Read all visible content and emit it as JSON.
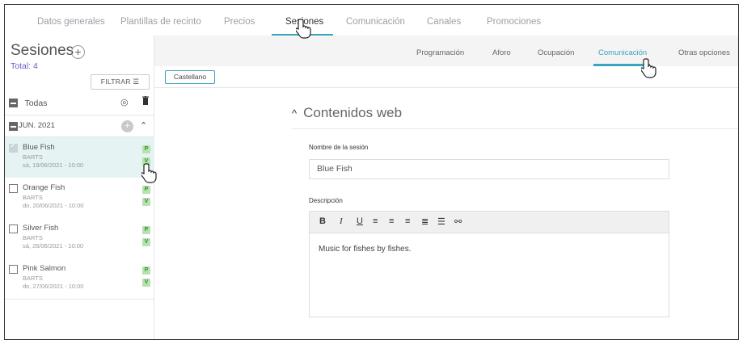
{
  "top_tabs": [
    "Datos generales",
    "Plantillas de recinto",
    "Precios",
    "Sesiones",
    "Comunicación",
    "Canales",
    "Promociones"
  ],
  "active_top_tab": "Sesiones",
  "sidebar": {
    "title": "Sesiones",
    "add_icon": "plus-icon",
    "total": "Total: 4",
    "filter_label": "FILTRAR",
    "select_all_label": "Todas",
    "group_label": "JUN. 2021",
    "items": [
      {
        "name": "Blue Fish",
        "venue": "BARTS",
        "date": "sá, 19/06/2021 - 10:00",
        "selected": true
      },
      {
        "name": "Orange Fish",
        "venue": "BARTS",
        "date": "do, 20/06/2021 - 10:00",
        "selected": false
      },
      {
        "name": "Silver Fish",
        "venue": "BARTS",
        "date": "sá, 26/06/2021 - 10:00",
        "selected": false
      },
      {
        "name": "Pink Salmon",
        "venue": "BARTS",
        "date": "do, 27/06/2021 - 10:00",
        "selected": false
      }
    ],
    "badge_p": "P",
    "badge_v": "V"
  },
  "sub_tabs": [
    "Programación",
    "Aforo",
    "Ocupación",
    "Comunicación",
    "Otras opciones"
  ],
  "active_sub_tab": "Comunicación",
  "language_button": "Castellano",
  "section_title": "Contenidos web",
  "session_name_label": "Nombre de la sesión",
  "session_name_value": "Blue Fish",
  "description_label": "Descripción",
  "description_value": "Music for fishes by fishes.",
  "colors": {
    "accent": "#39a3c0",
    "total": "#6b5fc4",
    "selected_row": "#e6f3f3"
  }
}
